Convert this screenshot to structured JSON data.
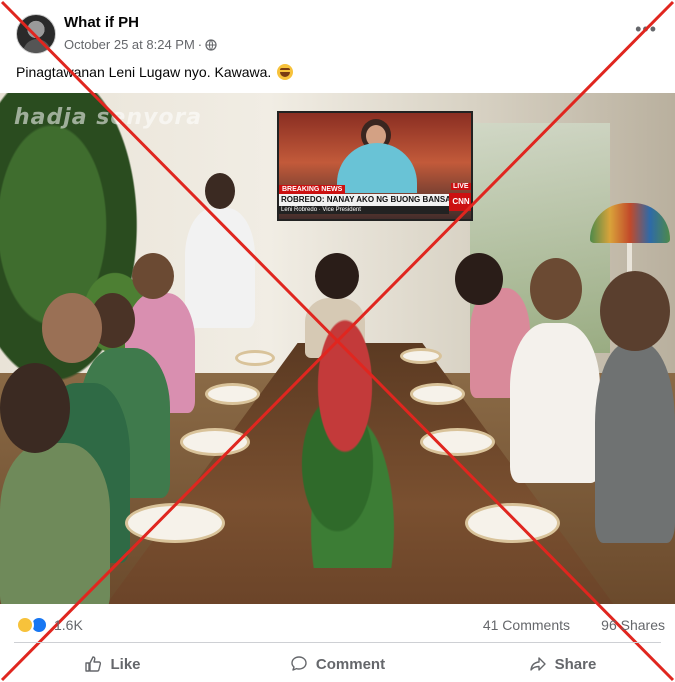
{
  "post": {
    "page_name": "What if PH",
    "timestamp": "October 25 at 8:24 PM",
    "separator": "·",
    "audience_icon": "globe-icon",
    "more_icon": "more-options-icon",
    "caption": "Pinagtawanan Leni Lugaw nyo. Kawawa.",
    "caption_emoji": "laughing-emoji"
  },
  "photo": {
    "watermark": "hadja senyora",
    "tv": {
      "breaking": "BREAKING NEWS",
      "headline": "ROBREDO: NANAY AKO NG BUONG BANSA",
      "subline": "Leni Robredo · Vice President",
      "live": "LIVE",
      "network": "CNN"
    },
    "overlay": "red-x-cross"
  },
  "stats": {
    "reaction_count": "1.6K",
    "comments": "41 Comments",
    "shares": "96 Shares",
    "reaction_icons": [
      "haha-reaction-icon",
      "like-reaction-icon"
    ]
  },
  "actions": {
    "like": "Like",
    "comment": "Comment",
    "share": "Share"
  },
  "colors": {
    "cross": "#e0261f",
    "muted_text": "#65676b",
    "like_blue": "#1877f2"
  }
}
